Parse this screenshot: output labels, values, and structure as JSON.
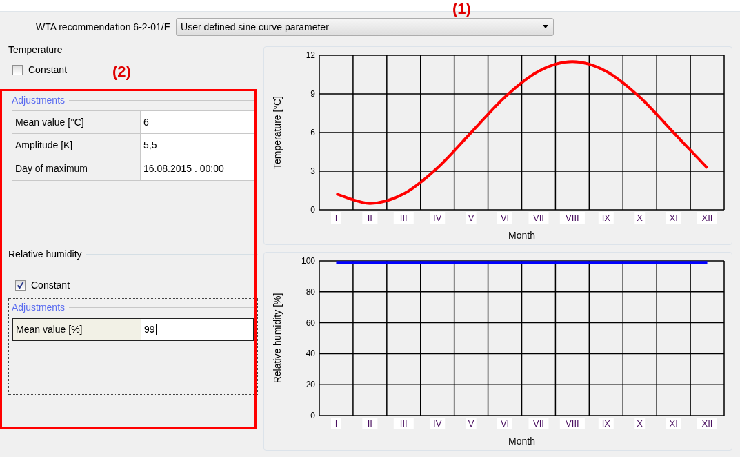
{
  "norm": {
    "label": "WTA recommendation 6-2-01/E",
    "value": "User defined sine curve parameter"
  },
  "callouts": [
    {
      "label": "(1)"
    },
    {
      "label": "(2)"
    }
  ],
  "sections": [
    {
      "title": "Temperature",
      "constant": {
        "label": "Constant",
        "checked": false
      },
      "group_title": "Adjustments",
      "rows": [
        {
          "label": "Mean value  [°C]",
          "value": "6",
          "selected": false
        },
        {
          "label": "Amplitude  [K]",
          "value": "5,5",
          "selected": false
        },
        {
          "label": "Day of maximum",
          "value": "16.08.2015 . 00:00",
          "selected": false
        }
      ],
      "chart_data": {
        "type": "line",
        "xlabel": "Month",
        "ylabel": "Temperature [°C]",
        "categories": [
          "I",
          "II",
          "III",
          "IV",
          "V",
          "VI",
          "VII",
          "VIII",
          "IX",
          "X",
          "XI",
          "XII"
        ],
        "series": [
          {
            "color": "#ff0000",
            "values": [
              1.24,
              0.5,
              1.24,
              3.25,
              6,
              8.75,
              10.76,
              11.5,
              10.76,
              8.75,
              6,
              3.25
            ]
          }
        ],
        "ylim": [
          0,
          12
        ],
        "yticks": [
          0,
          3,
          6,
          9,
          12
        ],
        "grid": true
      }
    },
    {
      "title": "Relative humidity",
      "constant": {
        "label": "Constant",
        "checked": true
      },
      "group_title": "Adjustments",
      "rows": [
        {
          "label": "Mean value  [%]",
          "value": "99",
          "selected": true
        }
      ],
      "chart_data": {
        "type": "line",
        "xlabel": "Month",
        "ylabel": "Relative humidity [%]",
        "categories": [
          "I",
          "II",
          "III",
          "IV",
          "V",
          "VI",
          "VII",
          "VIII",
          "IX",
          "X",
          "XI",
          "XII"
        ],
        "series": [
          {
            "color": "#0000ff",
            "values": [
              99,
              99,
              99,
              99,
              99,
              99,
              99,
              99,
              99,
              99,
              99,
              99
            ]
          }
        ],
        "ylim": [
          0,
          100
        ],
        "yticks": [
          0,
          20,
          40,
          60,
          80,
          100
        ],
        "grid": true
      }
    }
  ]
}
